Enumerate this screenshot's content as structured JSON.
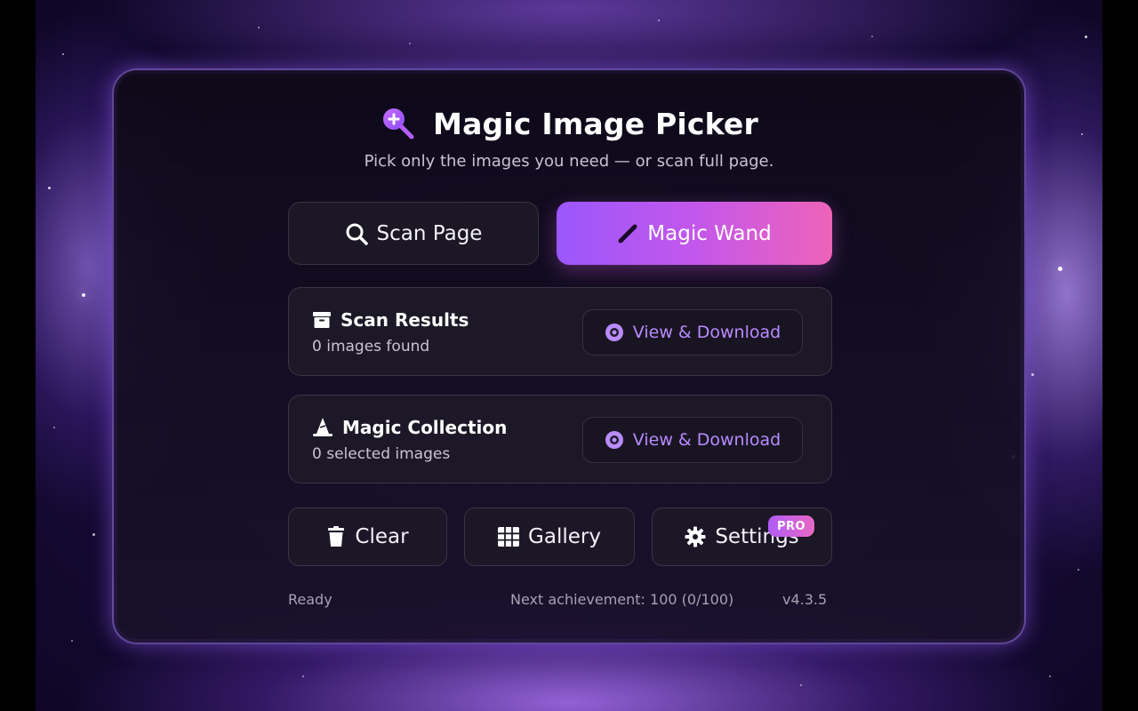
{
  "app": {
    "title": "Magic Image Picker",
    "subtitle": "Pick only the images you need — or scan full page.",
    "logo_icon": "magnifier-plus-icon"
  },
  "actions": {
    "scan_page": {
      "label": "Scan Page",
      "icon": "search-icon"
    },
    "magic_wand": {
      "label": "Magic Wand",
      "icon": "wand-icon"
    }
  },
  "cards": {
    "scan_results": {
      "title": "Scan Results",
      "subtitle": "0 images found",
      "icon": "archive-box-icon",
      "button_label": "View & Download",
      "button_icon": "eye-icon"
    },
    "magic_collection": {
      "title": "Magic Collection",
      "subtitle": "0 selected images",
      "icon": "wizard-hat-icon",
      "button_label": "View & Download",
      "button_icon": "eye-icon"
    }
  },
  "tools": {
    "clear": {
      "label": "Clear",
      "icon": "trash-icon"
    },
    "gallery": {
      "label": "Gallery",
      "icon": "grid-icon"
    },
    "settings": {
      "label": "Settings",
      "icon": "gear-icon",
      "badge": "PRO"
    }
  },
  "footer": {
    "status": "Ready",
    "achievement": "Next achievement: 100 (0/100)",
    "version": "v4.3.5"
  },
  "colors": {
    "accent": "#b98bff",
    "primary_gradient_start": "#9b57fb",
    "primary_gradient_end": "#ee63b8",
    "panel_border": "#a078ff"
  }
}
